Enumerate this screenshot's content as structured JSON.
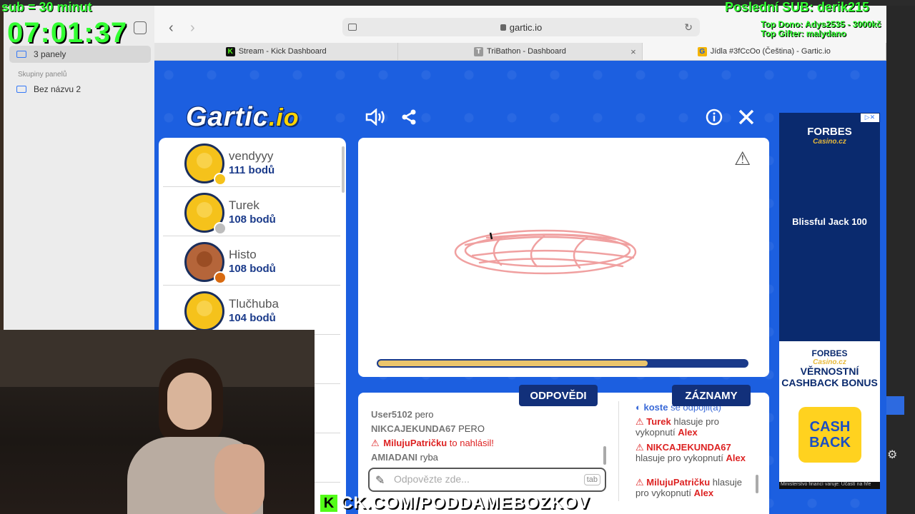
{
  "overlay": {
    "sub_rule": "sub = 30 minut",
    "clock": "07:01:37",
    "last_sub": "Poslední SUB: derik215",
    "top_donor": "Top Dono: Adys2535 - 3000kč",
    "top_gifter": "Top Gifter: malydano",
    "kick_url": "CK.COM/PODDAMEBOZKOV",
    "kick_letter": "K"
  },
  "sidebar": {
    "tab_group": "3 panely",
    "groups_header": "Skupiny panelů",
    "untitled_group": "Bez názvu 2"
  },
  "browser": {
    "url": "gartic.io",
    "back": "‹",
    "forward": "›",
    "tabs": [
      {
        "label": "Stream - Kick Dashboard",
        "favicon": "K",
        "color": "#111"
      },
      {
        "label": "TriBathon - Dashboard",
        "favicon": "T",
        "color": "#888"
      },
      {
        "label": "Jídla #3fCcOo (Čeština) - Gartic.io",
        "favicon": "G",
        "color": "#f5b400"
      }
    ]
  },
  "gartic": {
    "logo_main": "Gartic",
    "logo_io": ".io",
    "timer_fraction": 0.73,
    "players": [
      {
        "name": "vendyyy",
        "score": "111 bodů",
        "badge": "#f5c21b",
        "dark": false
      },
      {
        "name": "Turek",
        "score": "108 bodů",
        "badge": "#bdbdbd",
        "dark": false
      },
      {
        "name": "Histo",
        "score": "108 bodů",
        "badge": "#d86a10",
        "dark": true
      },
      {
        "name": "Tlučhuba",
        "score": "104 bodů",
        "badge": "",
        "dark": false
      }
    ],
    "tab_answers": "ODPOVĚDI",
    "tab_log": "ZÁZNAMY",
    "answers": [
      {
        "user": "User5102",
        "text": "pero"
      },
      {
        "user": "NIKCAJEKUNDA67",
        "text": "PERO"
      },
      {
        "user": "MilujuPatričku",
        "text": "to nahlásil!"
      },
      {
        "user": "AMIADANI",
        "text": "ryba"
      }
    ],
    "input_placeholder": "Odpovězte zde...",
    "tab_hint": "tab",
    "log": [
      {
        "user": "koste",
        "text": "se odpojil(a)"
      },
      {
        "user": "Turek",
        "text": "hlasuje pro vykopnutí",
        "target": "Alex"
      },
      {
        "user": "NIKCAJEKUNDA67",
        "text": "hlasuje pro vykopnutí",
        "target": "Alex"
      },
      {
        "user": "MilujuPatričku",
        "text": "hlasuje pro vykopnutí",
        "target": "Alex"
      }
    ]
  },
  "ads": {
    "brand": "FORBES",
    "brand_sub": "Casino.cz",
    "game": "Blissful Jack 100",
    "brand2": "FORBES",
    "brand2_sub": "Casino.cz",
    "title": "VĚRNOSTNÍ CASHBACK BONUS",
    "cash": "CASH BACK",
    "note": "Ministerstvo financí varuje: Účastí na hře"
  }
}
